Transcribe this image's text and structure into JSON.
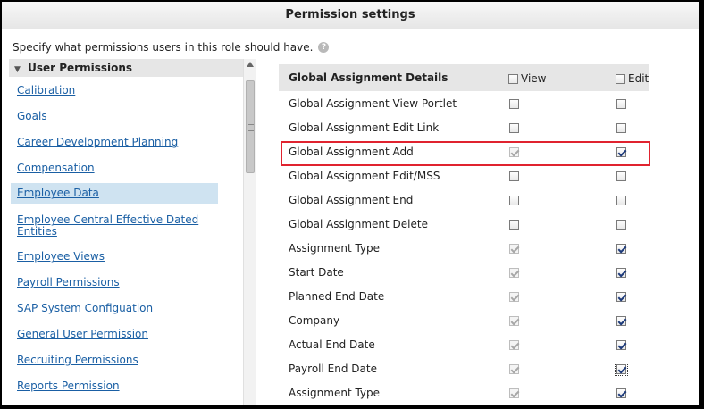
{
  "window": {
    "title": "Permission settings"
  },
  "instructions": {
    "text": "Specify what permissions users in this role should have.",
    "help_glyph": "?"
  },
  "left": {
    "header": "User Permissions",
    "items": [
      {
        "label": "Calibration"
      },
      {
        "label": "Goals"
      },
      {
        "label": "Career Development Planning"
      },
      {
        "label": "Compensation"
      },
      {
        "label": "Employee Data",
        "selected": true
      },
      {
        "label": "Employee Central Effective Dated Entities"
      },
      {
        "label": "Employee Views"
      },
      {
        "label": "Payroll Permissions"
      },
      {
        "label": "SAP System Configuation"
      },
      {
        "label": "General User Permission"
      },
      {
        "label": "Recruiting Permissions"
      },
      {
        "label": "Reports Permission"
      }
    ]
  },
  "permissions": {
    "header": {
      "label": "Global Assignment Details",
      "view_label": "View",
      "edit_label": "Edit"
    },
    "rows": [
      {
        "label": "Global Assignment View Portlet",
        "view": false,
        "view_disabled": false,
        "edit": false
      },
      {
        "label": "Global Assignment Edit Link",
        "view": false,
        "view_disabled": false,
        "edit": false
      },
      {
        "label": "Global Assignment Add",
        "view": true,
        "view_disabled": true,
        "edit": true
      },
      {
        "label": "Global Assignment Edit/MSS",
        "view": false,
        "view_disabled": false,
        "edit": false
      },
      {
        "label": "Global Assignment End",
        "view": false,
        "view_disabled": false,
        "edit": false
      },
      {
        "label": "Global Assignment Delete",
        "view": false,
        "view_disabled": false,
        "edit": false
      },
      {
        "label": "Assignment Type",
        "view": true,
        "view_disabled": true,
        "edit": true
      },
      {
        "label": "Start Date",
        "view": true,
        "view_disabled": true,
        "edit": true
      },
      {
        "label": "Planned End Date",
        "view": true,
        "view_disabled": true,
        "edit": true
      },
      {
        "label": "Company",
        "view": true,
        "view_disabled": true,
        "edit": true
      },
      {
        "label": "Actual End Date",
        "view": true,
        "view_disabled": true,
        "edit": true
      },
      {
        "label": "Payroll End Date",
        "view": true,
        "view_disabled": true,
        "edit": true,
        "edit_focus": true
      },
      {
        "label": "Assignment Type",
        "view": true,
        "view_disabled": true,
        "edit": true
      }
    ]
  },
  "colors": {
    "link": "#1a5fa4",
    "highlight_border": "#e0232f",
    "selected_bg": "#cfe3f1"
  }
}
